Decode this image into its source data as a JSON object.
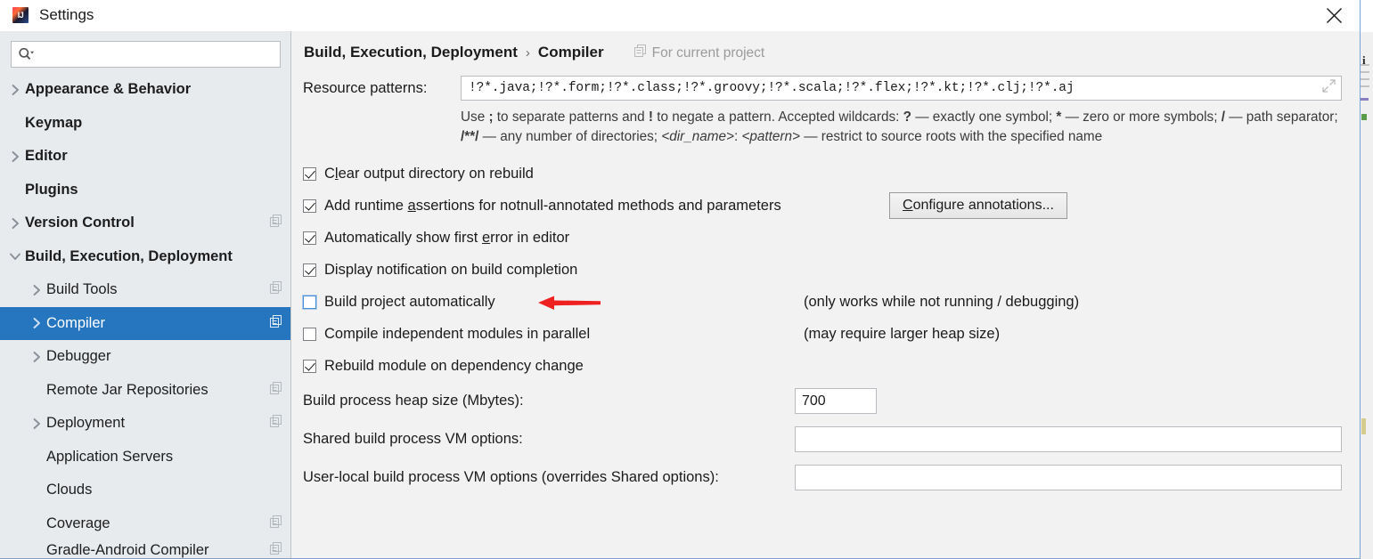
{
  "window": {
    "title": "Settings",
    "logo_icon": "intellij-idea-logo",
    "close_icon": "close-icon"
  },
  "sidebar": {
    "search": {
      "placeholder": "",
      "value": "",
      "icon": "search-icon",
      "dropdown_icon": "chevron-down-icon"
    },
    "items": [
      {
        "label": "Appearance & Behavior",
        "level": 0,
        "bold": true,
        "arrow": "collapsed",
        "scope_icon": false,
        "selected": false
      },
      {
        "label": "Keymap",
        "level": 0,
        "bold": true,
        "arrow": "none",
        "scope_icon": false,
        "selected": false
      },
      {
        "label": "Editor",
        "level": 0,
        "bold": true,
        "arrow": "collapsed",
        "scope_icon": false,
        "selected": false
      },
      {
        "label": "Plugins",
        "level": 0,
        "bold": true,
        "arrow": "none",
        "scope_icon": false,
        "selected": false
      },
      {
        "label": "Version Control",
        "level": 0,
        "bold": true,
        "arrow": "collapsed",
        "scope_icon": true,
        "selected": false
      },
      {
        "label": "Build, Execution, Deployment",
        "level": 0,
        "bold": true,
        "arrow": "expanded",
        "scope_icon": false,
        "selected": false
      },
      {
        "label": "Build Tools",
        "level": 1,
        "bold": false,
        "arrow": "collapsed",
        "scope_icon": true,
        "selected": false
      },
      {
        "label": "Compiler",
        "level": 1,
        "bold": false,
        "arrow": "collapsed",
        "scope_icon": true,
        "selected": true
      },
      {
        "label": "Debugger",
        "level": 1,
        "bold": false,
        "arrow": "collapsed",
        "scope_icon": false,
        "selected": false
      },
      {
        "label": "Remote Jar Repositories",
        "level": 1,
        "bold": false,
        "arrow": "none",
        "scope_icon": true,
        "selected": false
      },
      {
        "label": "Deployment",
        "level": 1,
        "bold": false,
        "arrow": "collapsed",
        "scope_icon": true,
        "selected": false
      },
      {
        "label": "Application Servers",
        "level": 1,
        "bold": false,
        "arrow": "none",
        "scope_icon": false,
        "selected": false
      },
      {
        "label": "Clouds",
        "level": 1,
        "bold": false,
        "arrow": "none",
        "scope_icon": false,
        "selected": false
      },
      {
        "label": "Coverage",
        "level": 1,
        "bold": false,
        "arrow": "none",
        "scope_icon": true,
        "selected": false
      },
      {
        "label": "Gradle-Android Compiler",
        "level": 1,
        "bold": false,
        "arrow": "none",
        "scope_icon": true,
        "selected": false
      }
    ]
  },
  "main": {
    "breadcrumb": {
      "parent": "Build, Execution, Deployment",
      "separator": "›",
      "current": "Compiler",
      "scope_label": "For current project",
      "scope_icon": "project-scope-icon"
    },
    "resource_patterns": {
      "label": "Resource patterns:",
      "value": "!?*.java;!?*.form;!?*.class;!?*.groovy;!?*.scala;!?*.flex;!?*.kt;!?*.clj;!?*.aj",
      "expand_icon": "expand-diagonal-icon"
    },
    "help": {
      "t1": "Use ",
      "b1": ";",
      "t2": " to separate patterns and ",
      "b2": "!",
      "t3": " to negate a pattern. Accepted wildcards: ",
      "b3": "?",
      "t4": " — exactly one symbol; ",
      "b4": "*",
      "t5": " — zero or more symbols; ",
      "b5": "/",
      "t6": " — path separator; ",
      "b6": "/**/",
      "t7": " — any number of directories; ",
      "i1": "<dir_name>",
      "t8": ": ",
      "i2": "<pattern>",
      "t9": " — restrict to source roots with the specified name"
    },
    "checkboxes": [
      {
        "label_pre": "C",
        "mnemonic": "l",
        "label_post": "ear output directory on rebuild",
        "checked": true,
        "focused": false,
        "hint": "",
        "button": ""
      },
      {
        "label_pre": "Add runtime ",
        "mnemonic": "a",
        "label_post": "ssertions for notnull-annotated methods and parameters",
        "checked": true,
        "focused": false,
        "hint": "",
        "button": "Configure annotations..."
      },
      {
        "label_pre": "Automatically show first ",
        "mnemonic": "e",
        "label_post": "rror in editor",
        "checked": true,
        "focused": false,
        "hint": "",
        "button": ""
      },
      {
        "label_pre": "Display notification on build completion",
        "mnemonic": "",
        "label_post": "",
        "checked": true,
        "focused": false,
        "hint": "",
        "button": ""
      },
      {
        "label_pre": "Build project automatically",
        "mnemonic": "",
        "label_post": "",
        "checked": false,
        "focused": true,
        "hint": "(only works while not running / debugging)",
        "button": ""
      },
      {
        "label_pre": "Compile independent modules in parallel",
        "mnemonic": "",
        "label_post": "",
        "checked": false,
        "focused": false,
        "hint": "(may require larger heap size)",
        "button": ""
      },
      {
        "label_pre": "Rebuild module on dependency change",
        "mnemonic": "",
        "label_post": "",
        "checked": true,
        "focused": false,
        "hint": "",
        "button": ""
      }
    ],
    "button_mnemonic": "C",
    "button_rest": "onfigure annotations...",
    "fields": [
      {
        "label": "Build process heap size (Mbytes):",
        "value": "700",
        "placeholder": "",
        "kind": "heap"
      },
      {
        "label": "Shared build process VM options:",
        "value": "",
        "placeholder": "",
        "kind": "shared"
      },
      {
        "label": "User-local build process VM options (overrides Shared options):",
        "value": "",
        "placeholder": "",
        "kind": "userloc"
      }
    ],
    "annotation": {
      "icon": "red-arrow-left"
    }
  },
  "colors": {
    "selection": "#2675bf",
    "sidebar_bg": "#e8ebee",
    "panel_bg": "#f2f2f2",
    "annotation_red": "#ef2020",
    "dialog_border": "#7aa3d8"
  }
}
